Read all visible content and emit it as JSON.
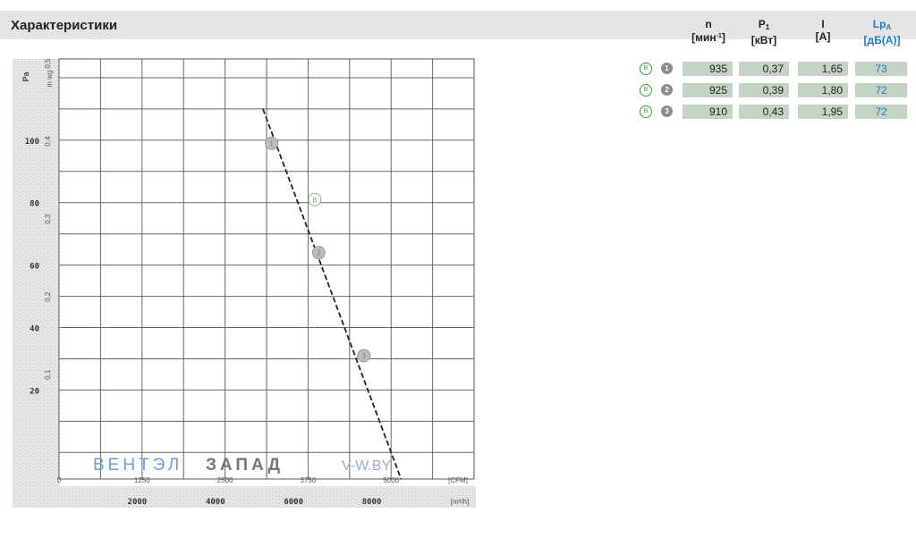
{
  "header": {
    "title": "Характеристики",
    "columns": [
      {
        "symbol": "n",
        "unit": "[мин",
        "unit_sup": "-1",
        "unit_end": "]",
        "accent": false
      },
      {
        "symbol": "P",
        "symbol_sub": "1",
        "unit": "[кВт]",
        "accent": false
      },
      {
        "symbol": "I",
        "unit": "[A]",
        "accent": false
      },
      {
        "symbol": "Lp",
        "symbol_sub": "A",
        "unit": "[дБ(A)]",
        "accent": true
      }
    ]
  },
  "operating_points": [
    {
      "badge": "B",
      "number": "1",
      "n": "935",
      "p1": "0,37",
      "i": "1,65",
      "lpa": "73"
    },
    {
      "badge": "B",
      "number": "2",
      "n": "925",
      "p1": "0,39",
      "i": "1,80",
      "lpa": "72"
    },
    {
      "badge": "B",
      "number": "3",
      "n": "910",
      "p1": "0,43",
      "i": "1,95",
      "lpa": "72"
    }
  ],
  "colors": {
    "header_bg": "#e4e4e4",
    "cell_bg": "#c5d3c5",
    "accent": "#1a7dc0",
    "badge_green": "#3a9b3a",
    "watermark_blue": "#6b9fd4",
    "watermark_gray": "#777777"
  },
  "chart_data": {
    "type": "line",
    "y_axis": {
      "label": "Pa",
      "ticks": [
        "20",
        "40",
        "60",
        "80",
        "100"
      ],
      "ylim": [
        -8.5,
        126
      ]
    },
    "y_axis_secondary": {
      "label": "in wg",
      "ticks": [
        "0,1",
        "0,2",
        "0,3",
        "0,4",
        "0,5"
      ]
    },
    "x_axis_top": {
      "unit": "[CFM]",
      "ticks": [
        "0",
        "1250",
        "2500",
        "3750",
        "5000"
      ],
      "xlim": [
        0,
        6250
      ]
    },
    "x_axis_bottom": {
      "unit": "[m³/h]",
      "ticks": [
        "2000",
        "4000",
        "6000",
        "8000"
      ]
    },
    "grid": true,
    "series": [
      {
        "style": "dashed",
        "x": [
          3070,
          5150
        ],
        "y": [
          110,
          -8.5
        ]
      }
    ],
    "points": [
      {
        "label": "1",
        "x": 3200,
        "y": 99
      },
      {
        "label": "B",
        "x": 3850,
        "y": 81
      },
      {
        "label": "2",
        "x": 3910,
        "y": 64
      },
      {
        "label": "3",
        "x": 4590,
        "y": 31
      }
    ],
    "watermark": {
      "part1": "ВЕНТЭЛ",
      "part2": "ЗАПАД",
      "part3": "V-W.BY"
    }
  }
}
